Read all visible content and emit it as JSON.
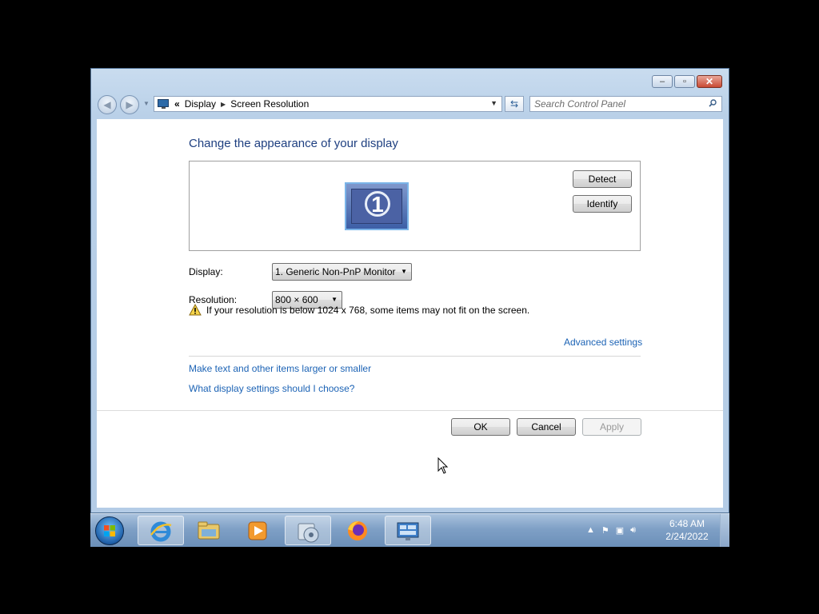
{
  "window": {
    "caption_buttons": [
      "minimize-icon",
      "restore-icon",
      "close-icon"
    ]
  },
  "address_bar": {
    "prefix": "«",
    "crumbs": [
      "Display",
      "Screen Resolution"
    ]
  },
  "search": {
    "placeholder": "Search Control Panel"
  },
  "main": {
    "title": "Change the appearance of your display",
    "monitor_number": "1",
    "detect_label": "Detect",
    "identify_label": "Identify",
    "display_label": "Display:",
    "display_value": "1. Generic Non-PnP Monitor",
    "resolution_label": "Resolution:",
    "resolution_value": "800 × 600",
    "warning_text": "If your resolution is below 1024 x 768, some items may not fit on the screen.",
    "advanced_link": "Advanced settings",
    "link_text_size": "Make text and other items larger or smaller",
    "link_help": "What display settings should I choose?",
    "ok_label": "OK",
    "cancel_label": "Cancel",
    "apply_label": "Apply"
  },
  "taskbar": {
    "apps": [
      "internet-explorer-icon",
      "windows-explorer-icon",
      "media-player-icon",
      "media-center-icon",
      "firefox-icon",
      "display-settings-icon"
    ],
    "active_app": "display-settings-icon",
    "time": "6:48 AM",
    "date": "2/24/2022"
  },
  "colors": {
    "title": "#1e3f80",
    "link": "#1c63b5",
    "taskbar": "#7fa0c6"
  }
}
